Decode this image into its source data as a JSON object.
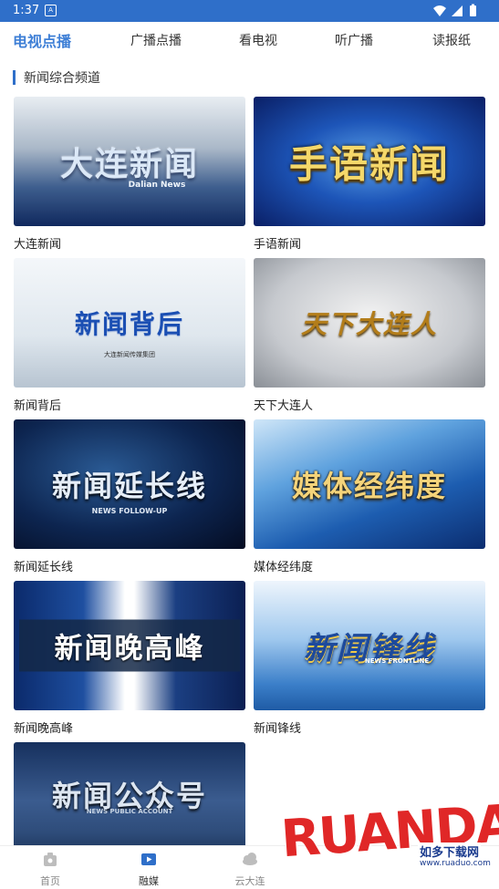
{
  "status_bar": {
    "time": "1:37",
    "notification_glyph": "A"
  },
  "top_tabs": [
    {
      "label": "电视点播",
      "active": true
    },
    {
      "label": "广播点播",
      "active": false
    },
    {
      "label": "看电视",
      "active": false
    },
    {
      "label": "听广播",
      "active": false
    },
    {
      "label": "读报纸",
      "active": false
    }
  ],
  "section": {
    "title": "新闻综合频道"
  },
  "programs": [
    {
      "title": "大连新闻",
      "thumb_text": "大连新闻",
      "thumb_sub": "Dalian News"
    },
    {
      "title": "手语新闻",
      "thumb_text": "手语新闻",
      "thumb_sub": ""
    },
    {
      "title": "新闻背后",
      "thumb_text": "新闻背后",
      "thumb_sub": "大连新闻传媒集团"
    },
    {
      "title": "天下大连人",
      "thumb_text": "天下大连人",
      "thumb_sub": ""
    },
    {
      "title": "新闻延长线",
      "thumb_text": "新闻延长线",
      "thumb_sub": "NEWS FOLLOW-UP"
    },
    {
      "title": "媒体经纬度",
      "thumb_text": "媒体经纬度",
      "thumb_sub": ""
    },
    {
      "title": "新闻晚高峰",
      "thumb_text": "新闻晚高峰",
      "thumb_sub": ""
    },
    {
      "title": "新闻锋线",
      "thumb_text": "新闻锋线",
      "thumb_sub": "NEWS FRONTLINE"
    },
    {
      "title": "",
      "thumb_text": "新闻公众号",
      "thumb_sub": "NEWS PUBLIC ACCOUNT"
    }
  ],
  "bottom_nav": [
    {
      "label": "首页",
      "icon": "home-icon",
      "active": false
    },
    {
      "label": "融媒",
      "icon": "media-play-icon",
      "active": true
    },
    {
      "label": "云大连",
      "icon": "cloud-icon",
      "active": false
    }
  ],
  "watermark": {
    "logo": "RUANDAO",
    "text": "如多下载网",
    "url": "www.ruaduo.com"
  },
  "colors": {
    "accent": "#3e7fd6",
    "status_bar": "#2f6fc9",
    "watermark_red": "#e02727"
  }
}
